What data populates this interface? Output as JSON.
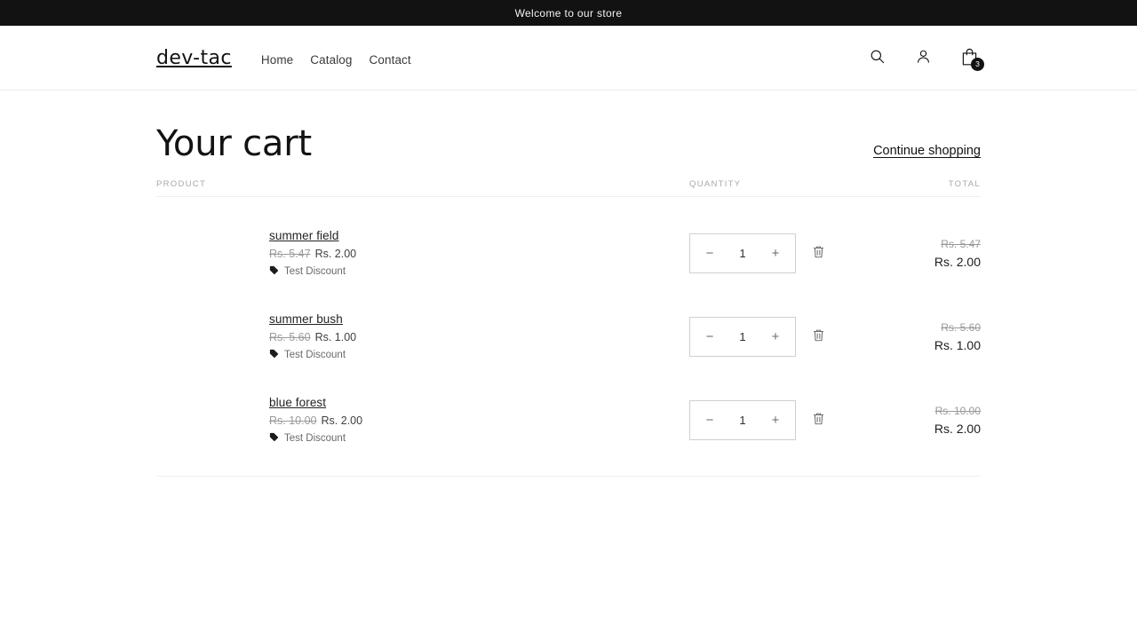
{
  "announcement": {
    "text": "Welcome to our store"
  },
  "header": {
    "logo": "dev-tac",
    "nav": [
      {
        "label": "Home"
      },
      {
        "label": "Catalog"
      },
      {
        "label": "Contact"
      }
    ],
    "icons": {
      "search": "search-icon",
      "account": "account-icon",
      "cart": "shopping-bag-icon"
    },
    "cart_count": "3"
  },
  "cart": {
    "title": "Your cart",
    "continue_shopping": "Continue shopping",
    "columns": {
      "product": "PRODUCT",
      "quantity": "QUANTITY",
      "total": "TOTAL"
    },
    "items": [
      {
        "title": "summer field",
        "price_old": "Rs. 5.47",
        "price_new": "Rs. 2.00",
        "discount_label": "Test Discount",
        "quantity": "1",
        "decrease_label": "−",
        "increase_label": "+",
        "total_old": "Rs. 5.47",
        "total_new": "Rs. 2.00"
      },
      {
        "title": "summer bush",
        "price_old": "Rs. 5.60",
        "price_new": "Rs. 1.00",
        "discount_label": "Test Discount",
        "quantity": "1",
        "decrease_label": "−",
        "increase_label": "+",
        "total_old": "Rs. 5.60",
        "total_new": "Rs. 1.00"
      },
      {
        "title": "blue forest",
        "price_old": "Rs. 10.00",
        "price_new": "Rs. 2.00",
        "discount_label": "Test Discount",
        "quantity": "1",
        "decrease_label": "−",
        "increase_label": "+",
        "total_old": "Rs. 10.00",
        "total_new": "Rs. 2.00"
      }
    ]
  },
  "colors": {
    "announcement_bg": "#121212",
    "text": "#121212",
    "muted": "#a8a8a8",
    "border": "#efefef"
  }
}
